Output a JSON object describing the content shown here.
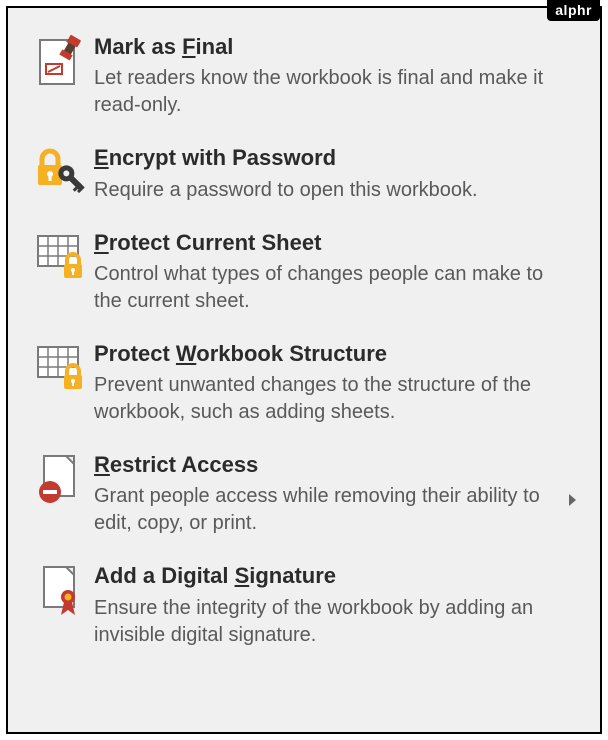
{
  "watermark": "alphr",
  "menu": {
    "items": [
      {
        "title_pre": "Mark as ",
        "title_u": "F",
        "title_post": "inal",
        "desc": "Let readers know the workbook is final and make it read-only.",
        "has_submenu": false
      },
      {
        "title_pre": "",
        "title_u": "E",
        "title_post": "ncrypt with Password",
        "desc": "Require a password to open this workbook.",
        "has_submenu": false
      },
      {
        "title_pre": "",
        "title_u": "P",
        "title_post": "rotect Current Sheet",
        "desc": "Control what types of changes people can make to the current sheet.",
        "has_submenu": false
      },
      {
        "title_pre": "Protect ",
        "title_u": "W",
        "title_post": "orkbook Structure",
        "desc": "Prevent unwanted changes to the structure of the workbook, such as adding sheets.",
        "has_submenu": false
      },
      {
        "title_pre": "",
        "title_u": "R",
        "title_post": "estrict Access",
        "desc": "Grant people access while removing their ability to edit, copy, or print.",
        "has_submenu": true
      },
      {
        "title_pre": "Add a Digital ",
        "title_u": "S",
        "title_post": "ignature",
        "desc": "Ensure the integrity of the workbook by adding an invisible digital signature.",
        "has_submenu": false
      }
    ]
  }
}
